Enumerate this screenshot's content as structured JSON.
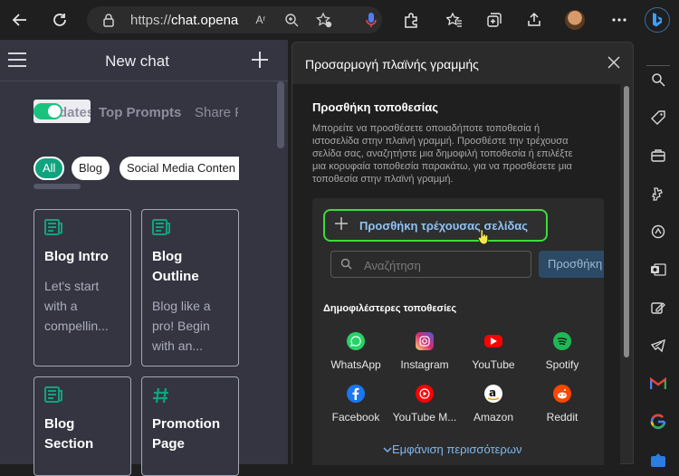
{
  "browser": {
    "url_prefix": "https://",
    "url_host": "chat.opena",
    "reader_glyph": "Aʳ"
  },
  "chatgpt": {
    "title": "New chat",
    "tabs": [
      "Updates",
      "Top Prompts",
      "Share F"
    ],
    "chips": [
      "All",
      "Blog",
      "Social Media Conten"
    ],
    "cards": [
      {
        "title": "Blog Intro",
        "desc": "Let's start with a compellin...",
        "icon": "newspaper-icon"
      },
      {
        "title": "Blog Outline",
        "desc": "Blog like a pro! Begin with an...",
        "icon": "newspaper-icon"
      },
      {
        "title": "Blog Section",
        "desc": "",
        "icon": "newspaper-icon"
      },
      {
        "title": "Promotion Page",
        "desc": "",
        "icon": "hash-icon"
      }
    ]
  },
  "sidebar_dialog": {
    "title": "Προσαρμογή πλαϊνής γραμμής",
    "section_title": "Προσθήκη τοποθεσίας",
    "section_desc": "Μπορείτε να προσθέσετε οποιαδήποτε τοποθεσία ή ιστοσελίδα στην πλαϊνή γραμμή. Προσθέστε την τρέχουσα σελίδα σας, αναζητήστε μια δημοφιλή τοποθεσία ή επιλέξτε μια κορυφαία τοποθεσία παρακάτω, για να προσθέσετε μια τοποθεσία στην πλαϊνή γραμμή.",
    "add_current_label": "Προσθήκη τρέχουσας σελίδας",
    "search_placeholder": "Αναζήτηση",
    "search_button": "Προσθήκη",
    "popular_title": "Δημοφιλέστερες τοποθεσίες",
    "sites": [
      {
        "label": "WhatsApp",
        "color": "#25d366"
      },
      {
        "label": "Instagram",
        "color": "#d6249f"
      },
      {
        "label": "YouTube",
        "color": "#ff0000"
      },
      {
        "label": "Spotify",
        "color": "#1db954"
      },
      {
        "label": "Facebook",
        "color": "#1877f2"
      },
      {
        "label": "YouTube M...",
        "color": "#ff0000"
      },
      {
        "label": "Amazon",
        "color": "#ffffff"
      },
      {
        "label": "Reddit",
        "color": "#ff4500"
      }
    ],
    "show_more": "Εμφάνιση περισσότερων"
  },
  "colors": {
    "accent_green": "#10a37f",
    "highlight": "#3bdc3b",
    "link_blue": "#7fb8f0"
  }
}
